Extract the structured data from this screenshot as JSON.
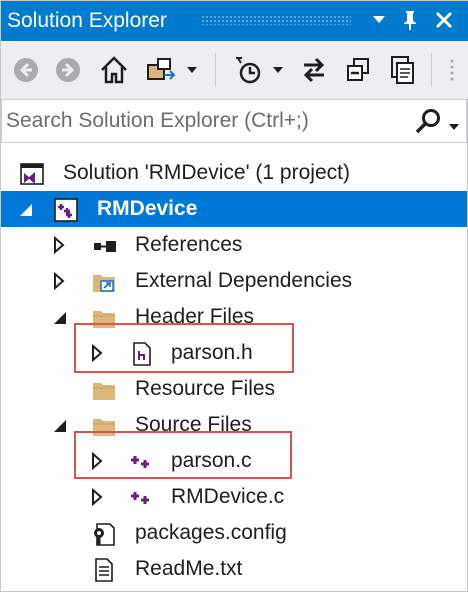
{
  "window": {
    "title": "Solution Explorer",
    "controls": [
      "dropdown-icon",
      "pin-icon",
      "close-icon"
    ],
    "accent_color": "#007acc"
  },
  "toolbar": {
    "buttons": [
      "back-icon",
      "forward-icon",
      "home-icon",
      "switch-views-icon",
      "pending-changes-filter-icon",
      "sync-icon",
      "collapse-all-icon",
      "show-all-files-icon"
    ]
  },
  "search": {
    "placeholder": "Search Solution Explorer (Ctrl+;)"
  },
  "tree": {
    "solution": "Solution 'RMDevice' (1 project)",
    "project": "RMDevice",
    "references": "References",
    "external_dependencies": "External Dependencies",
    "header_files": "Header Files",
    "parson_h": "parson.h",
    "resource_files": "Resource Files",
    "source_files": "Source Files",
    "parson_c": "parson.c",
    "rmdevice_c": "RMDevice.c",
    "packages_config": "packages.config",
    "readme": "ReadMe.txt"
  },
  "colors": {
    "selection": "#0078d7",
    "highlight_box": "#d9534f",
    "cpp_icon": "#68217a",
    "folder": "#dcb67a"
  }
}
